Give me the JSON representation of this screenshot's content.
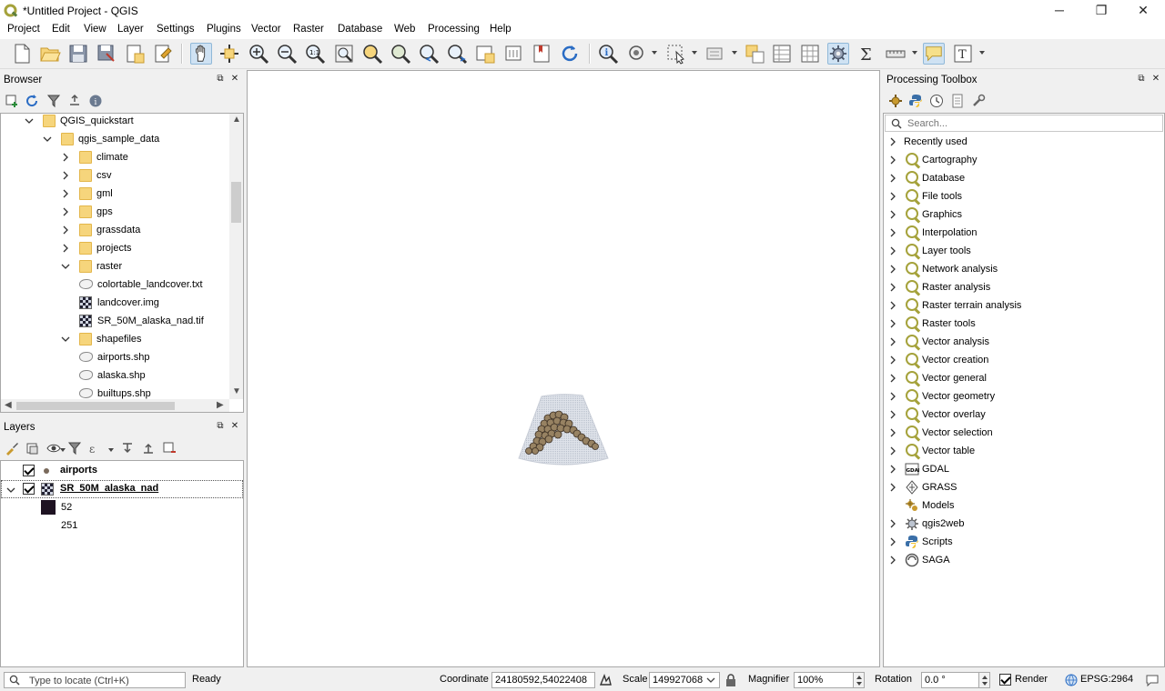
{
  "window": {
    "title": "*Untitled Project - QGIS",
    "controls": {
      "minimize": "─",
      "maximize": "❐",
      "close": "✕"
    }
  },
  "menubar": {
    "items": [
      "Project",
      "Edit",
      "View",
      "Layer",
      "Settings",
      "Plugins",
      "Vector",
      "Raster",
      "Database",
      "Web",
      "Processing",
      "Help"
    ]
  },
  "toolbar": {
    "active_tool": "pan-map",
    "accent": "#cfe2f3"
  },
  "browser": {
    "title": "Browser",
    "items": [
      {
        "label": "QGIS_quickstart",
        "kind": "folder",
        "expanded": true
      },
      {
        "label": "qgis_sample_data",
        "kind": "folder",
        "expanded": true
      },
      {
        "label": "climate",
        "kind": "folder",
        "expanded": false
      },
      {
        "label": "csv",
        "kind": "folder",
        "expanded": false
      },
      {
        "label": "gml",
        "kind": "folder",
        "expanded": false
      },
      {
        "label": "gps",
        "kind": "folder",
        "expanded": false
      },
      {
        "label": "grassdata",
        "kind": "folder",
        "expanded": false
      },
      {
        "label": "projects",
        "kind": "folder",
        "expanded": false
      },
      {
        "label": "raster",
        "kind": "folder",
        "expanded": true
      },
      {
        "label": "colortable_landcover.txt",
        "kind": "vector"
      },
      {
        "label": "landcover.img",
        "kind": "raster"
      },
      {
        "label": "SR_50M_alaska_nad.tif",
        "kind": "raster"
      },
      {
        "label": "shapefiles",
        "kind": "folder",
        "expanded": true
      },
      {
        "label": "airports.shp",
        "kind": "vector"
      },
      {
        "label": "alaska.shp",
        "kind": "vector"
      },
      {
        "label": "builtups.shp",
        "kind": "vector"
      }
    ]
  },
  "layers": {
    "title": "Layers",
    "items": [
      {
        "label": "airports",
        "checked": true,
        "kind": "point"
      },
      {
        "label": "SR_50M_alaska_nad",
        "checked": true,
        "kind": "raster",
        "expanded": true
      }
    ],
    "legend": [
      {
        "label": "52",
        "color": "#1e1222"
      },
      {
        "label": "251",
        "color": "#ffffff"
      }
    ]
  },
  "toolbox": {
    "title": "Processing Toolbox",
    "search_placeholder": "Search...",
    "items": [
      {
        "label": "Recently used",
        "icon": "none"
      },
      {
        "label": "Cartography",
        "icon": "qgis"
      },
      {
        "label": "Database",
        "icon": "qgis"
      },
      {
        "label": "File tools",
        "icon": "qgis"
      },
      {
        "label": "Graphics",
        "icon": "qgis"
      },
      {
        "label": "Interpolation",
        "icon": "qgis"
      },
      {
        "label": "Layer tools",
        "icon": "qgis"
      },
      {
        "label": "Network analysis",
        "icon": "qgis"
      },
      {
        "label": "Raster analysis",
        "icon": "qgis"
      },
      {
        "label": "Raster terrain analysis",
        "icon": "qgis"
      },
      {
        "label": "Raster tools",
        "icon": "qgis"
      },
      {
        "label": "Vector analysis",
        "icon": "qgis"
      },
      {
        "label": "Vector creation",
        "icon": "qgis"
      },
      {
        "label": "Vector general",
        "icon": "qgis"
      },
      {
        "label": "Vector geometry",
        "icon": "qgis"
      },
      {
        "label": "Vector overlay",
        "icon": "qgis"
      },
      {
        "label": "Vector selection",
        "icon": "qgis"
      },
      {
        "label": "Vector table",
        "icon": "qgis"
      },
      {
        "label": "GDAL",
        "icon": "gdal"
      },
      {
        "label": "GRASS",
        "icon": "grass"
      },
      {
        "label": "Models",
        "icon": "models"
      },
      {
        "label": "qgis2web",
        "icon": "gear"
      },
      {
        "label": "Scripts",
        "icon": "python"
      },
      {
        "label": "SAGA",
        "icon": "saga"
      }
    ]
  },
  "statusbar": {
    "locate_placeholder": "Type to locate (Ctrl+K)",
    "status": "Ready",
    "coordinate_label": "Coordinate",
    "coordinate_value": "24180592,54022408",
    "scale_label": "Scale",
    "scale_value": "149927068",
    "magnifier_label": "Magnifier",
    "magnifier_value": "100%",
    "rotation_label": "Rotation",
    "rotation_value": "0.0 °",
    "render_label": "Render",
    "render_checked": true,
    "crs": "EPSG:2964"
  }
}
